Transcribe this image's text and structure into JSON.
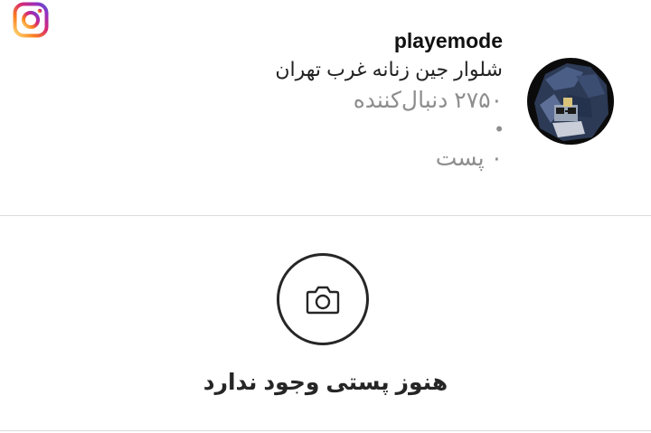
{
  "app": {
    "name": "Instagram",
    "accent_colors": [
      "#feda75",
      "#fa7e1e",
      "#d62976",
      "#962fbf",
      "#4f5bd5"
    ],
    "logo_icon": "instagram-logo-icon"
  },
  "profile": {
    "username": "playemode",
    "bio": "شلوار جین زنانه غرب تهران",
    "followers": "۲۷۵۰ دنبال‌کننده",
    "separator": "•",
    "posts": "۰ پست",
    "avatar_icon": "profile-avatar"
  },
  "empty_state": {
    "icon": "camera-icon",
    "message": "هنوز پستی وجود ندارد"
  }
}
